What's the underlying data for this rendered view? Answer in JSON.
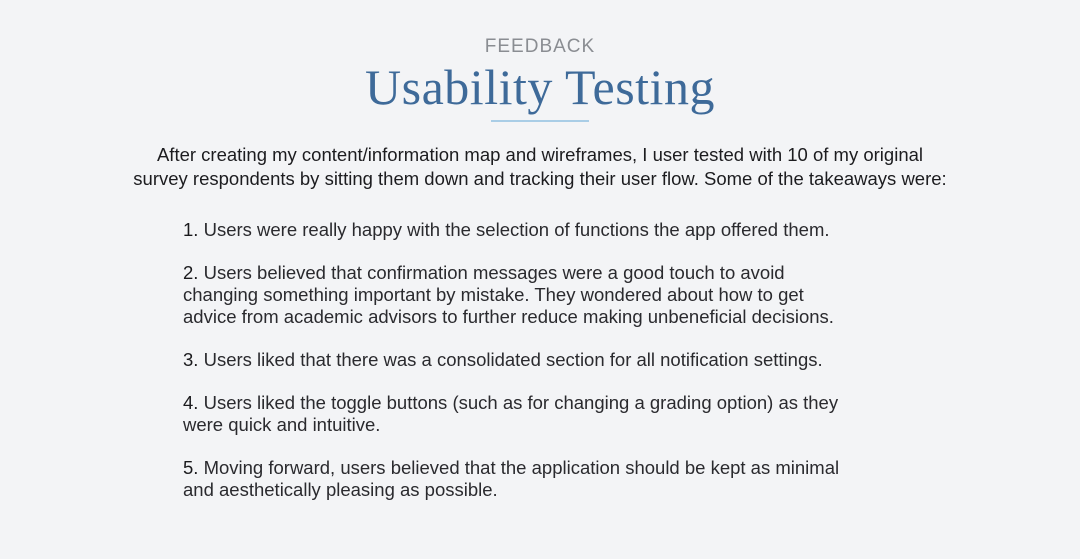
{
  "header": {
    "eyebrow": "FEEDBACK",
    "title": "Usability Testing"
  },
  "intro": {
    "line1": "After creating my content/information map and wireframes, I user tested with 10 of my original",
    "line2": "survey respondents by sitting them down and tracking their user flow. Some of the takeaways were:"
  },
  "takeaways": [
    {
      "number": "1.",
      "lines": [
        "Users were really happy with the selection of functions the app offered them."
      ]
    },
    {
      "number": "2.",
      "lines": [
        "Users believed that confirmation messages were a good touch to avoid",
        "changing something important by mistake. They wondered about how to get",
        "advice from academic advisors to further reduce making unbeneficial decisions."
      ]
    },
    {
      "number": "3.",
      "lines": [
        "Users liked that there was a consolidated section for all notification settings."
      ]
    },
    {
      "number": "4.",
      "lines": [
        "Users liked the toggle buttons (such as for changing a grading option) as they",
        "were quick and intuitive."
      ]
    },
    {
      "number": "5.",
      "lines": [
        "Moving forward, users believed that the application should be kept as minimal",
        "and aesthetically pleasing as possible."
      ]
    }
  ]
}
